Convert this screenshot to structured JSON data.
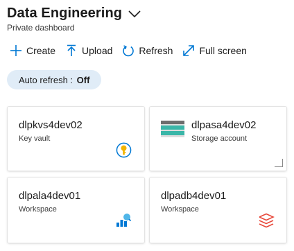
{
  "header": {
    "title": "Data Engineering",
    "subtitle": "Private dashboard",
    "title_dropdown_icon": "chevron-down-icon"
  },
  "toolbar": {
    "create_label": "Create",
    "upload_label": "Upload",
    "refresh_label": "Refresh",
    "fullscreen_label": "Full screen"
  },
  "auto_refresh": {
    "label": "Auto refresh :",
    "value": "Off"
  },
  "tiles": [
    {
      "name": "dlpkvs4dev02",
      "type": "Key vault",
      "icon": "key-vault-icon"
    },
    {
      "name": "dlpasa4dev02",
      "type": "Storage account",
      "icon": "storage-account-icon"
    },
    {
      "name": "dlpala4dev01",
      "type": "Workspace",
      "icon": "log-analytics-icon"
    },
    {
      "name": "dlpadb4dev01",
      "type": "Workspace",
      "icon": "databricks-icon"
    }
  ],
  "colors": {
    "accent": "#0078d4",
    "pill_background": "#e0ecf7",
    "key_vault_gold": "#f2b400",
    "databricks_red": "#e8483a",
    "storage_teal": "#3ab6a8"
  }
}
